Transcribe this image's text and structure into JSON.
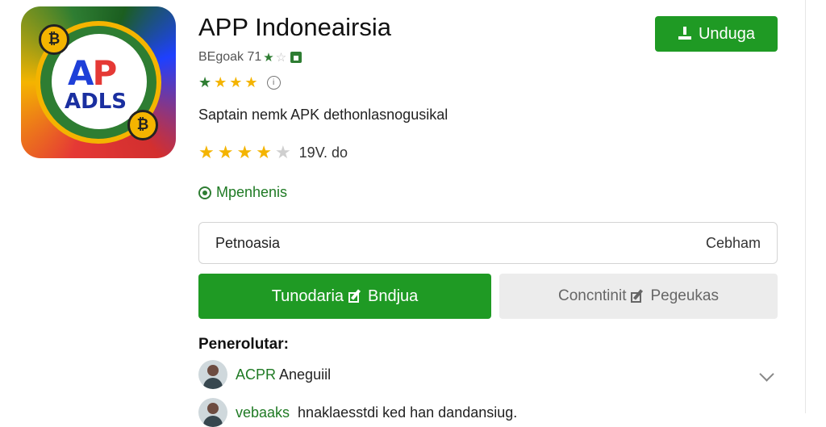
{
  "app": {
    "title": "APP Indoneairsia",
    "meta": "BEgoak 71",
    "description": "Saptain nemk APK dethonlasnogusikal",
    "rating_text": "19V. do",
    "status_label": "Mpenhenis",
    "icon_logo_top_a": "A",
    "icon_logo_top_p": "P",
    "icon_logo_bottom": "ADLS"
  },
  "header": {
    "download_label": "Unduga"
  },
  "field": {
    "left_text": "Petnoasia",
    "right_text": "Cebham"
  },
  "actions": {
    "primary_label_left": "Tunodaria",
    "primary_label_right": "Bndjua",
    "secondary_label_left": "Concntinit",
    "secondary_label_right": "Pegeukas"
  },
  "reviews": {
    "section_title": "Penerolutar:",
    "items": [
      {
        "name_green": "ACPR",
        "name_rest": "Aneguiil",
        "text": ""
      },
      {
        "name_green": "vebaaks",
        "name_rest": "",
        "text": "hnaklaesstdi ked han dandansiug."
      }
    ]
  },
  "colors": {
    "accent": "#1f9a24",
    "star": "#f4b400",
    "secondary_button": "#ececec"
  },
  "ratings": {
    "small_stars": 4,
    "big_stars_filled": 4,
    "big_stars_total": 5
  }
}
